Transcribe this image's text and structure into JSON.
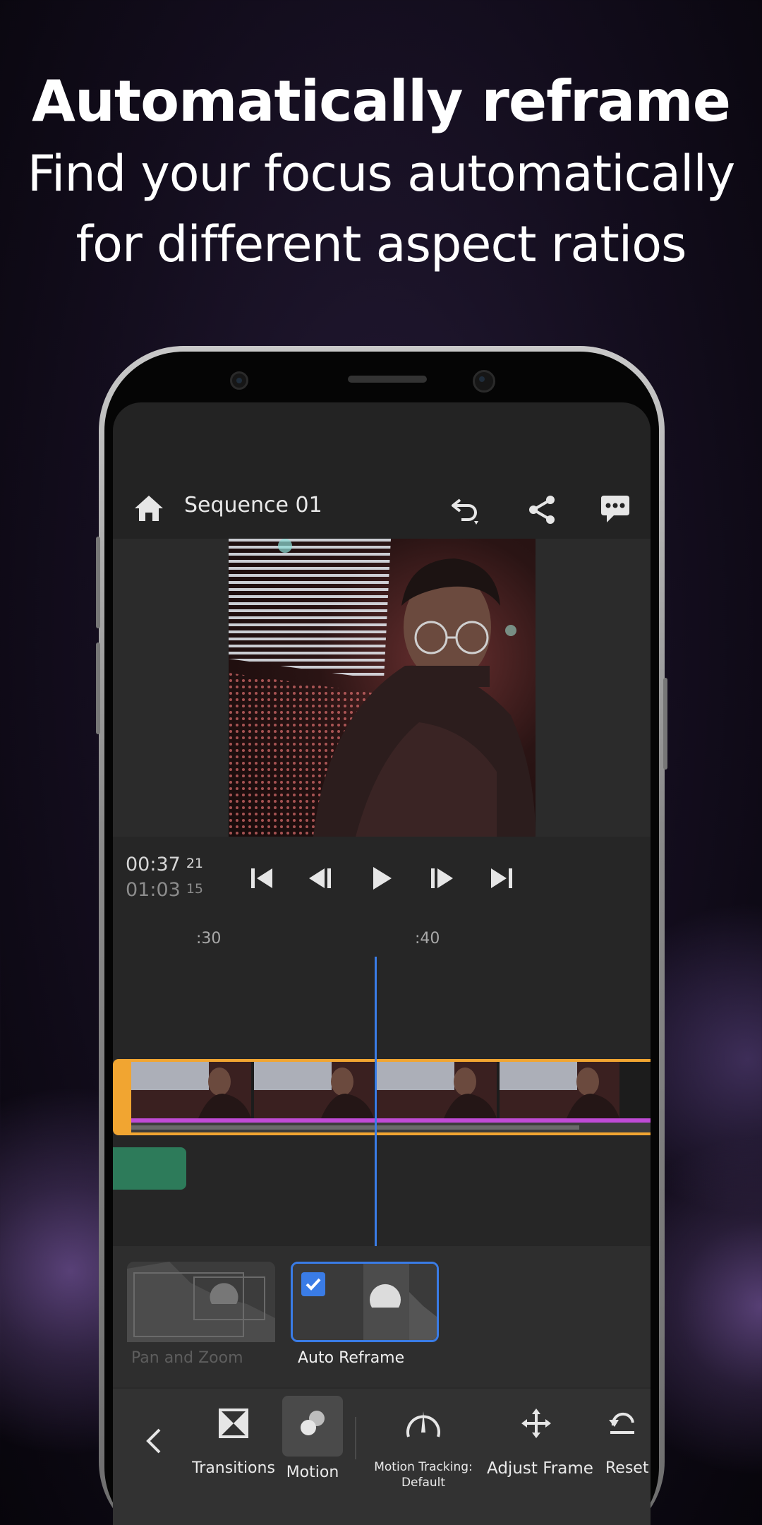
{
  "headline": {
    "title": "Automatically reframe",
    "line1": "Find your focus automatically",
    "line2": "for different aspect ratios"
  },
  "header": {
    "title": "Sequence 01",
    "icons": [
      "home-icon",
      "undo-icon",
      "share-icon",
      "comment-icon"
    ]
  },
  "transport": {
    "current": "00:37",
    "current_frames": "21",
    "duration": "01:03",
    "duration_frames": "15",
    "buttons": [
      "skip-to-start-icon",
      "step-back-icon",
      "play-icon",
      "step-forward-icon",
      "skip-to-end-icon"
    ]
  },
  "timeline": {
    "ticks": [
      ":30",
      ":40"
    ]
  },
  "effects": {
    "pan_zoom": "Pan and Zoom",
    "auto_reframe": "Auto Reframe"
  },
  "toolbar": {
    "transitions": "Transitions",
    "motion": "Motion",
    "motion_tracking_1": "Motion Tracking:",
    "motion_tracking_2": "Default",
    "adjust_frame": "Adjust Frame",
    "reset": "Reset"
  },
  "colors": {
    "accent_blue": "#3a7ce6",
    "clip_orange": "#f1a531",
    "effect_purple": "#c04bd6",
    "audio_green": "#2d7b5a"
  }
}
